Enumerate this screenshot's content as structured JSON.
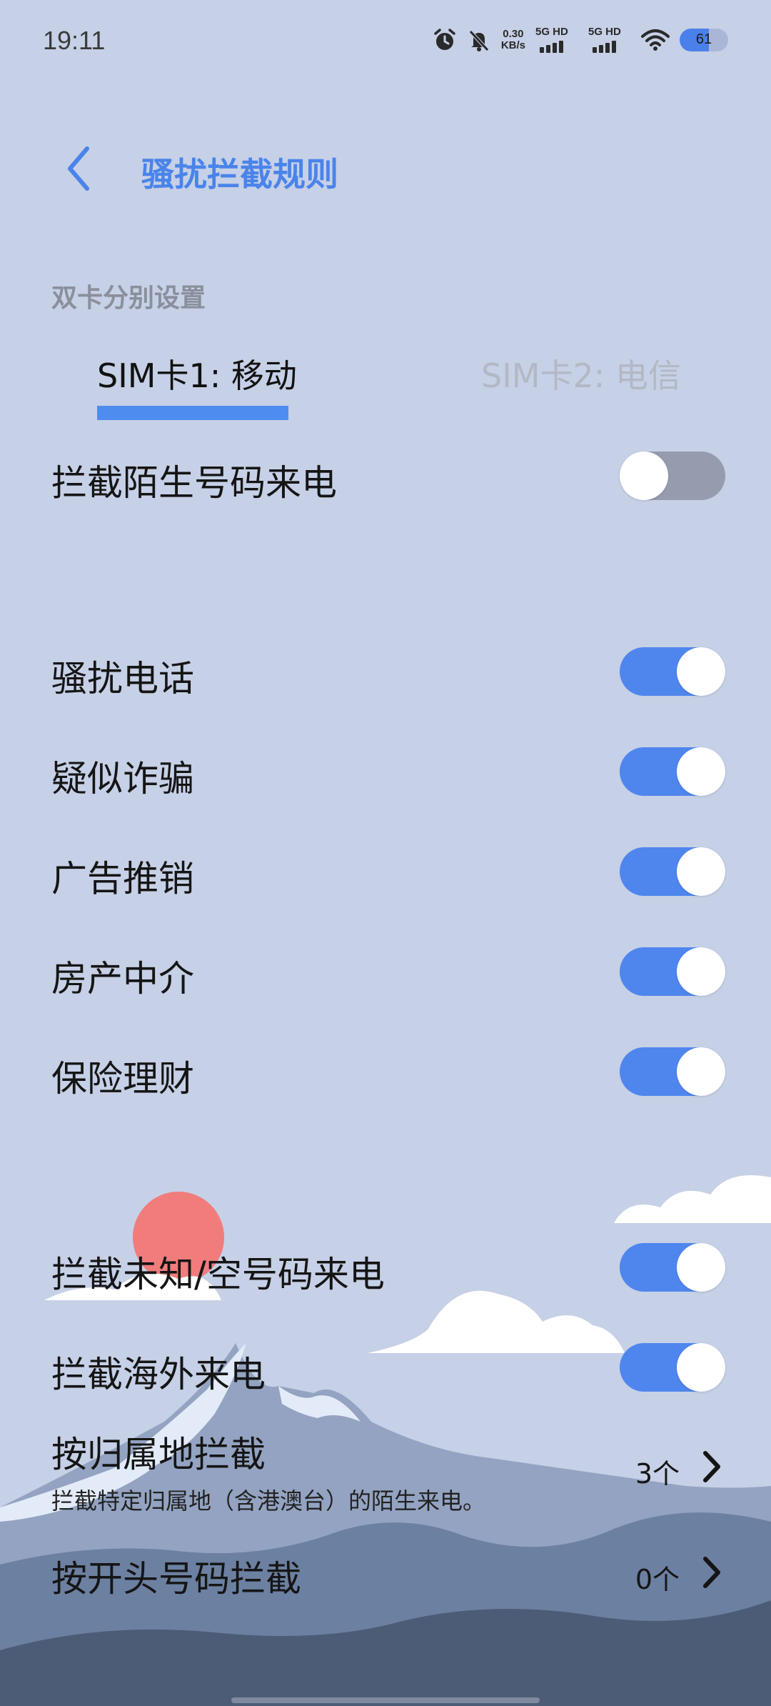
{
  "status_bar": {
    "time": "19:11",
    "net_speed_value": "0.30",
    "net_speed_unit": "KB/s",
    "sim1_network": "5G HD",
    "sim2_network": "5G HD",
    "battery_level": "61",
    "icons": [
      "alarm-icon",
      "mute-bell-icon",
      "wifi-icon"
    ]
  },
  "header": {
    "title": "骚扰拦截规则",
    "back_icon": "chevron-left-icon"
  },
  "section_label": "双卡分别设置",
  "tabs": [
    {
      "label": "SIM卡1: 移动",
      "selected": true
    },
    {
      "label": "SIM卡2: 电信",
      "selected": false
    }
  ],
  "settings": {
    "block_unknown_numbers": {
      "label": "拦截陌生号码来电",
      "on": false
    },
    "categories": [
      {
        "label": "骚扰电话",
        "on": true
      },
      {
        "label": "疑似诈骗",
        "on": true
      },
      {
        "label": "广告推销",
        "on": true
      },
      {
        "label": "房产中介",
        "on": true
      },
      {
        "label": "保险理财",
        "on": true
      }
    ],
    "block_invalid": {
      "label": "拦截未知/空号码来电",
      "on": true
    },
    "block_overseas": {
      "label": "拦截海外来电",
      "on": true
    },
    "by_location": {
      "label": "按归属地拦截",
      "description": "拦截特定归属地（含港澳台）的陌生来电。",
      "value": "3个"
    },
    "by_prefix": {
      "label": "按开头号码拦截",
      "value": "0个"
    }
  },
  "colors": {
    "background": "#c6d0e6",
    "accent": "#4f86ee",
    "toggle_off": "#949cae",
    "title": "#4a84ea"
  }
}
